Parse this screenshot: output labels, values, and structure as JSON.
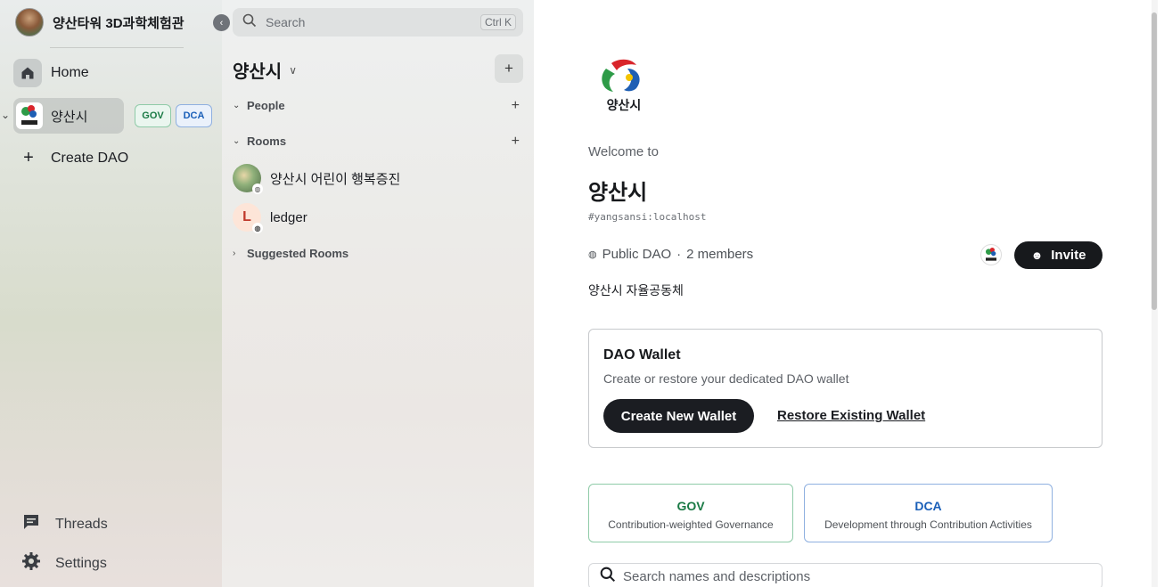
{
  "sidebar": {
    "user_name": "양산타워 3D과학체험관",
    "home_label": "Home",
    "space": {
      "name": "양산시",
      "tags": [
        "GOV",
        "DCA"
      ]
    },
    "create_label": "Create DAO",
    "threads_label": "Threads",
    "settings_label": "Settings",
    "icons": [
      "collapse-icon",
      "home-icon",
      "plus-icon",
      "threads-icon",
      "settings-icon"
    ]
  },
  "room_list": {
    "search_placeholder": "Search",
    "search_shortcut": "Ctrl K",
    "space_title": "양산시",
    "sections": {
      "people": "People",
      "rooms": "Rooms",
      "suggested": "Suggested Rooms"
    },
    "rooms": [
      {
        "name": "양산시 어린이 행복증진",
        "avatar": "photo"
      },
      {
        "name": "ledger",
        "avatar_letter": "L"
      }
    ]
  },
  "main": {
    "welcome": "Welcome to",
    "title": "양산시",
    "alias": "#yangsansi:localhost",
    "visibility": "Public DAO",
    "members": "2 members",
    "invite_label": "Invite",
    "topic": "양산시 자율공동체",
    "wallet": {
      "title": "DAO Wallet",
      "description": "Create or restore your dedicated DAO wallet",
      "create_label": "Create New Wallet",
      "restore_label": "Restore Existing Wallet"
    },
    "features": [
      {
        "title": "GOV",
        "subtitle": "Contribution-weighted Governance"
      },
      {
        "title": "DCA",
        "subtitle": "Development through Contribution Activities"
      }
    ],
    "search_placeholder": "Search names and descriptions",
    "colors": {
      "gov": "#1a7a45",
      "dca": "#1a5fb8",
      "dark": "#1b1d22"
    }
  }
}
